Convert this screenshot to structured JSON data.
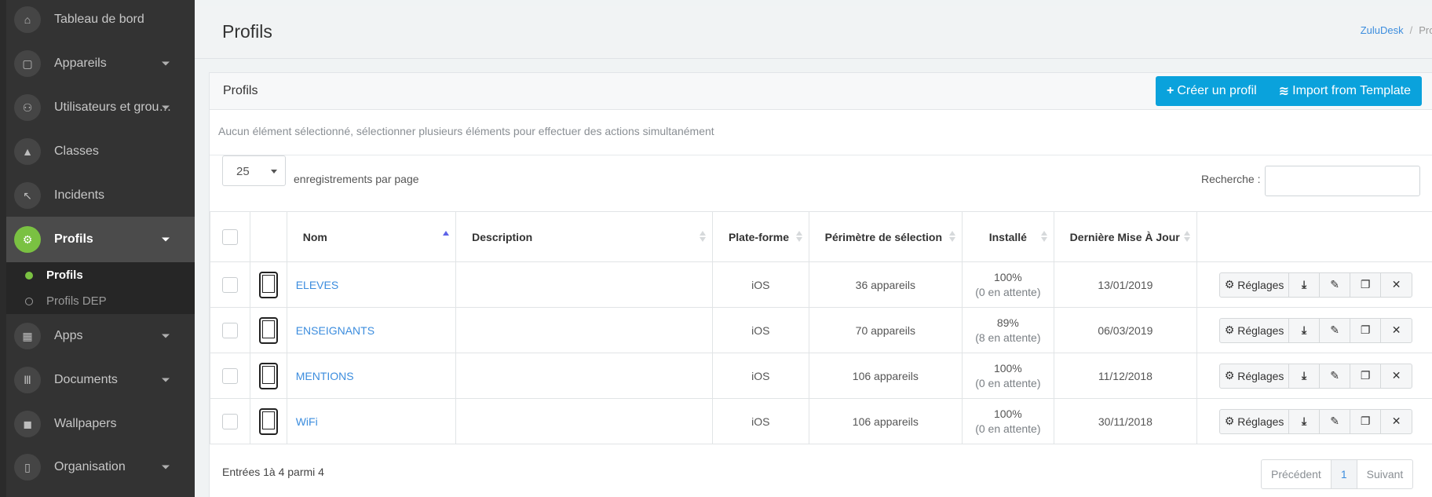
{
  "sidebar": {
    "items": [
      {
        "label": "Tableau de bord",
        "icon": "home-icon",
        "glyph": "⌂"
      },
      {
        "label": "Appareils",
        "icon": "device-icon",
        "glyph": "▢"
      },
      {
        "label": "Utilisateurs et grou…",
        "icon": "users-icon",
        "glyph": "⚇"
      },
      {
        "label": "Classes",
        "icon": "graduation-cap-icon",
        "glyph": "▲"
      },
      {
        "label": "Incidents",
        "icon": "wrench-icon",
        "glyph": "↖"
      },
      {
        "label": "Profils",
        "icon": "cogs-icon",
        "glyph": "⚙"
      },
      {
        "label": "Apps",
        "icon": "calculator-icon",
        "glyph": "▦"
      },
      {
        "label": "Documents",
        "icon": "books-icon",
        "glyph": "Ⅲ"
      },
      {
        "label": "Wallpapers",
        "icon": "paint-roller-icon",
        "glyph": "◼"
      },
      {
        "label": "Organisation",
        "icon": "building-icon",
        "glyph": "▯"
      }
    ],
    "submenu": [
      {
        "label": "Profils"
      },
      {
        "label": "Profils DEP"
      }
    ]
  },
  "header": {
    "title": "Profils",
    "breadcrumb": {
      "root": "ZuluDesk",
      "sep": "/",
      "current": "Profi"
    }
  },
  "panel": {
    "title": "Profils",
    "create_label": "Créer un profil",
    "import_label": "Import from Template",
    "notice": "Aucun élément sélectionné, sélectionner plusieurs éléments pour effectuer des actions simultanément",
    "page_size": "25",
    "page_size_label": "enregistrements par page",
    "search_label": "Recherche :"
  },
  "table": {
    "headers": {
      "name": "Nom",
      "description": "Description",
      "platform": "Plate-forme",
      "scope": "Périmètre de sélection",
      "installed": "Installé",
      "updated": "Dernière Mise À Jour"
    },
    "rows": [
      {
        "name": "ELEVES",
        "description": "",
        "platform": "iOS",
        "scope": "36 appareils",
        "installed": "100%",
        "pending": "(0 en attente)",
        "updated": "13/01/2019"
      },
      {
        "name": "ENSEIGNANTS",
        "description": "",
        "platform": "iOS",
        "scope": "70 appareils",
        "installed": "89%",
        "pending": "(8 en attente)",
        "updated": "06/03/2019"
      },
      {
        "name": "MENTIONS",
        "description": "",
        "platform": "iOS",
        "scope": "106 appareils",
        "installed": "100%",
        "pending": "(0 en attente)",
        "updated": "11/12/2018"
      },
      {
        "name": "WiFi",
        "description": "",
        "platform": "iOS",
        "scope": "106 appareils",
        "installed": "100%",
        "pending": "(0 en attente)",
        "updated": "30/11/2018"
      }
    ],
    "action_label": "Réglages"
  },
  "footer": {
    "entries": "Entrées 1à 4 parmi 4",
    "prev": "Précédent",
    "page": "1",
    "next": "Suivant"
  },
  "colors": {
    "accent": "#0aa2dc",
    "active_green": "#7ac142",
    "link": "#3c8dde",
    "sidebar_bg": "#333333"
  }
}
